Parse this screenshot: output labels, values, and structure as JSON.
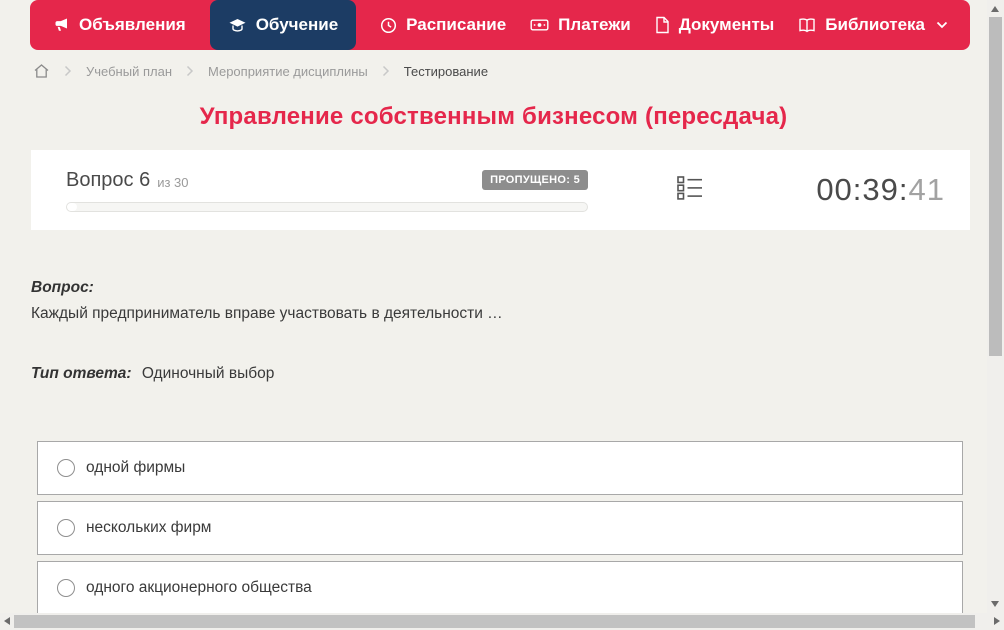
{
  "nav": {
    "items": [
      {
        "label": "Объявления",
        "icon": "megaphone",
        "active": false
      },
      {
        "label": "Обучение",
        "icon": "graduation-cap",
        "active": true
      },
      {
        "label": "Расписание",
        "icon": "clock",
        "active": false
      },
      {
        "label": "Платежи",
        "icon": "cash",
        "active": false
      },
      {
        "label": "Документы",
        "icon": "document",
        "active": false
      },
      {
        "label": "Библиотека",
        "icon": "open-book",
        "has_dropdown": true,
        "active": false
      }
    ]
  },
  "breadcrumb": {
    "home_icon": "home",
    "items": [
      "Учебный план",
      "Мероприятие дисциплины",
      "Тестирование"
    ]
  },
  "page_title": "Управление собственным бизнесом (пересдача)",
  "question_header": {
    "question_label": "Вопрос 6",
    "question_of": "из 30",
    "skipped_badge": "ПРОПУЩЕНО: 5",
    "progress_style": "width:10px",
    "question_list_icon": "question-list",
    "timer_hm": "00:39:",
    "timer_seconds": "41"
  },
  "question": {
    "label": "Вопрос:",
    "text": "Каждый предприниматель вправе участвовать в деятельности …",
    "type_label": "Тип ответа:",
    "type_value": "Одиночный выбор"
  },
  "answers": [
    {
      "label": "одной фирмы",
      "selected": false
    },
    {
      "label": "нескольких фирм",
      "selected": false
    },
    {
      "label": "одного акционерного общества",
      "selected": false
    }
  ],
  "colors": {
    "accent_red": "#e5274b",
    "active_navy": "#1c3c64",
    "page_bg": "#f2f1ec",
    "badge_gray": "#8d8d8d"
  }
}
